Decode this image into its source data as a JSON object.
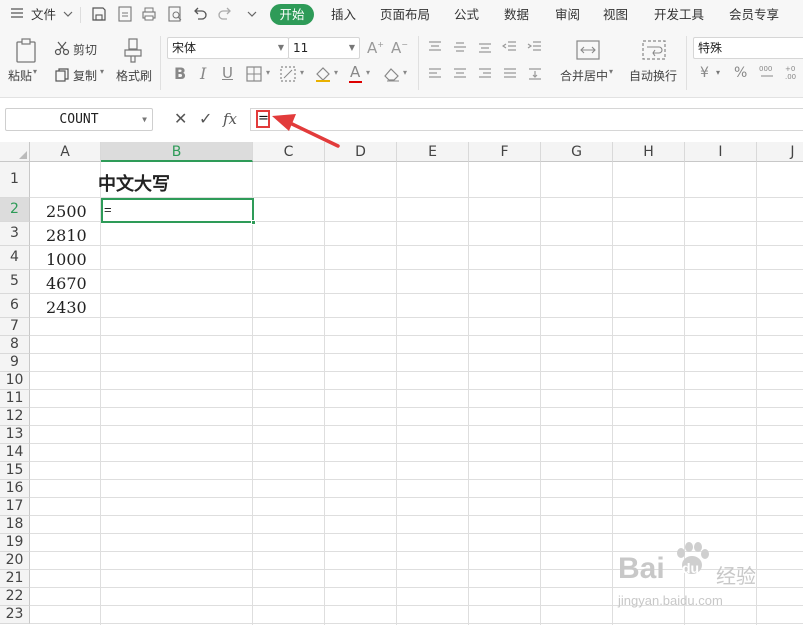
{
  "menu": {
    "file_label": "文件",
    "tabs": [
      "开始",
      "插入",
      "页面布局",
      "公式",
      "数据",
      "审阅",
      "视图",
      "开发工具",
      "会员专享"
    ]
  },
  "ribbon": {
    "paste_label": "粘贴",
    "cut_label": "剪切",
    "copy_label": "复制",
    "format_painter_label": "格式刷",
    "font_name": "宋体",
    "font_size": "11",
    "merge_center_label": "合并居中",
    "wrap_text_label": "自动换行",
    "number_format": "特殊",
    "currency_symbol": "¥",
    "percent_symbol": "%"
  },
  "formula_bar": {
    "name_box": "COUNT",
    "cancel_symbol": "✕",
    "enter_symbol": "✓",
    "fx_label": "fx",
    "content": "="
  },
  "sheet": {
    "columns": [
      "A",
      "B",
      "C",
      "D",
      "E",
      "F",
      "G",
      "H",
      "I",
      "J"
    ],
    "selected_column": "B",
    "rows": [
      "1",
      "2",
      "3",
      "4",
      "5",
      "6",
      "7",
      "8",
      "9",
      "10",
      "11",
      "12",
      "13",
      "14",
      "15",
      "16",
      "17",
      "18",
      "19",
      "20",
      "21",
      "22",
      "23"
    ],
    "selected_row": "2",
    "b1": "中文大写",
    "b2": "=",
    "a_values": [
      "2500",
      "2810",
      "1000",
      "4670",
      "2430"
    ]
  },
  "watermark": {
    "brand": "Bai",
    "brand2": "du",
    "brand3": "经验",
    "url": "jingyan.baidu.com"
  },
  "colors": {
    "accent": "#2e9b58",
    "highlight_red": "#e23b3b"
  }
}
